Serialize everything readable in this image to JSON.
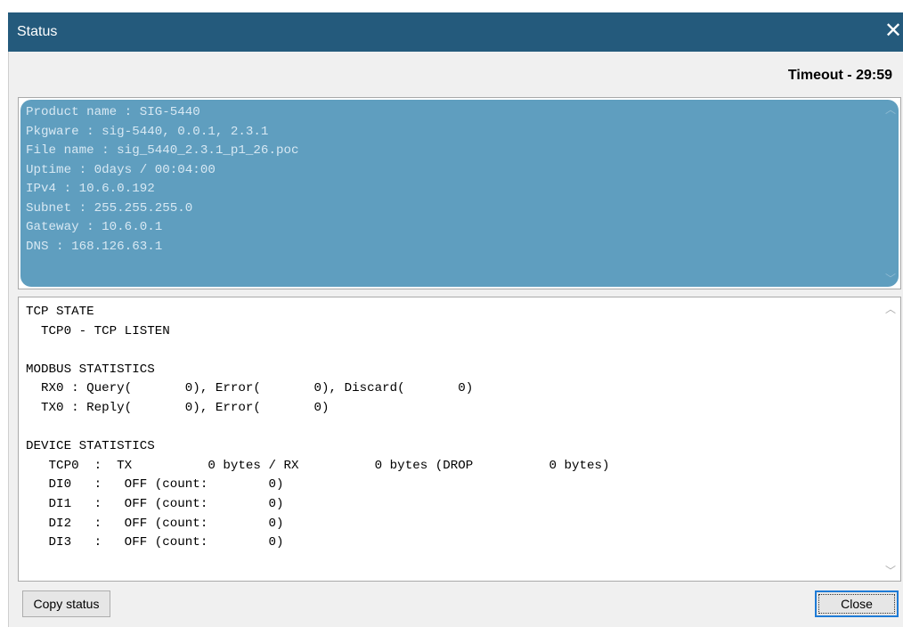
{
  "window": {
    "title": "Status",
    "close_glyph": "✕"
  },
  "timeout_text": "Timeout - 29:59",
  "info_pane": {
    "lines": [
      "Product name : SIG-5440",
      "Pkgware : sig-5440, 0.0.1, 2.3.1",
      "File name : sig_5440_2.3.1_p1_26.poc",
      "Uptime : 0days / 00:04:00",
      "IPv4 : 10.6.0.192",
      "Subnet : 255.255.255.0",
      "Gateway : 10.6.0.1",
      "DNS : 168.126.63.1"
    ]
  },
  "stats_pane": {
    "lines": [
      "TCP STATE",
      "  TCP0 - TCP LISTEN",
      "",
      "MODBUS STATISTICS",
      "  RX0 : Query(       0), Error(       0), Discard(       0)",
      "  TX0 : Reply(       0), Error(       0)",
      "",
      "DEVICE STATISTICS",
      "   TCP0  :  TX          0 bytes / RX          0 bytes (DROP          0 bytes)",
      "   DI0   :   OFF (count:        0)",
      "   DI1   :   OFF (count:        0)",
      "   DI2   :   OFF (count:        0)",
      "   DI3   :   OFF (count:        0)"
    ]
  },
  "buttons": {
    "copy": "Copy status",
    "close": "Close"
  },
  "icons": {
    "scroll_up": "chevron-up-icon",
    "scroll_down": "chevron-down-icon"
  },
  "colors": {
    "titlebar": "#245a7c",
    "selection": "#5f9ebf",
    "focus": "#1e7bd6"
  }
}
